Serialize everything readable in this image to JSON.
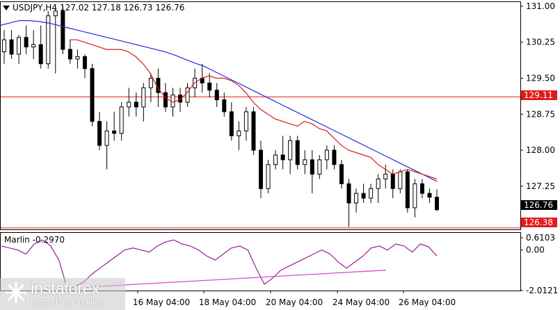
{
  "header": {
    "symbol": "USDJPY,H4",
    "ohlc": "127.02 127.18 126.73 126.76"
  },
  "indicator": {
    "label": "Marlin -0.2970"
  },
  "price_axis": [
    "131.00",
    "130.25",
    "129.50",
    "128.75",
    "128.00",
    "127.25",
    "126.50"
  ],
  "indicator_axis": [
    "0.6103",
    "0.00",
    "-2.0121"
  ],
  "time_axis": [
    "16 May 04:00",
    "18 May 04:00",
    "20 May 04:00",
    "24 May 04:00",
    "26 May 04:00"
  ],
  "price_tags": {
    "current": "126.76",
    "level_upper": "129.11",
    "level_lower": "126.38"
  },
  "colors": {
    "resistance": "#e31b1b",
    "ma_fast": "#d81b1b",
    "ma_slow": "#1f2fd6",
    "oscillator": "#9b1b9b",
    "trendline": "#d24bd6"
  },
  "logo": {
    "name": "instaforex",
    "tagline": "Instant Forex Trading"
  },
  "chart_data": {
    "type": "candlestick",
    "symbol": "USDJPY",
    "timeframe": "H4",
    "ylim": [
      126.35,
      131.1
    ],
    "horizontal_levels": [
      129.11,
      126.38
    ],
    "candles": [
      [
        130.05,
        130.5,
        129.8,
        130.3
      ],
      [
        130.3,
        130.5,
        129.9,
        130.0
      ],
      [
        130.0,
        130.4,
        129.8,
        130.35
      ],
      [
        130.35,
        130.6,
        130.0,
        130.15
      ],
      [
        130.15,
        130.5,
        129.9,
        130.2
      ],
      [
        130.2,
        130.6,
        129.7,
        129.8
      ],
      [
        129.8,
        130.9,
        129.7,
        130.8
      ],
      [
        130.8,
        131.0,
        129.6,
        130.9
      ],
      [
        130.9,
        131.0,
        130.0,
        130.1
      ],
      [
        130.1,
        130.3,
        129.8,
        129.9
      ],
      [
        129.9,
        130.1,
        129.7,
        129.95
      ],
      [
        129.95,
        130.0,
        129.5,
        129.7
      ],
      [
        129.7,
        129.8,
        128.5,
        128.6
      ],
      [
        128.6,
        128.8,
        128.0,
        128.1
      ],
      [
        128.1,
        128.6,
        127.6,
        128.4
      ],
      [
        128.4,
        128.8,
        128.2,
        128.35
      ],
      [
        128.35,
        129.0,
        128.2,
        128.9
      ],
      [
        128.9,
        129.3,
        128.7,
        129.0
      ],
      [
        129.0,
        129.2,
        128.7,
        128.9
      ],
      [
        128.9,
        129.4,
        128.6,
        129.3
      ],
      [
        129.3,
        129.6,
        129.0,
        129.5
      ],
      [
        129.5,
        129.7,
        128.9,
        129.2
      ],
      [
        129.2,
        129.4,
        128.8,
        128.9
      ],
      [
        128.9,
        129.3,
        128.7,
        129.15
      ],
      [
        129.15,
        129.3,
        128.8,
        129.0
      ],
      [
        129.0,
        129.4,
        128.9,
        129.3
      ],
      [
        129.3,
        129.7,
        129.1,
        129.5
      ],
      [
        129.5,
        129.8,
        129.2,
        129.4
      ],
      [
        129.4,
        129.6,
        129.1,
        129.25
      ],
      [
        129.25,
        129.4,
        128.9,
        129.05
      ],
      [
        129.05,
        129.2,
        128.7,
        128.8
      ],
      [
        128.8,
        129.0,
        128.2,
        128.3
      ],
      [
        128.3,
        128.6,
        128.0,
        128.4
      ],
      [
        128.4,
        128.9,
        128.2,
        128.8
      ],
      [
        128.8,
        128.9,
        127.9,
        128.0
      ],
      [
        128.0,
        128.2,
        127.0,
        127.2
      ],
      [
        127.2,
        127.8,
        127.1,
        127.7
      ],
      [
        127.7,
        128.0,
        127.6,
        127.9
      ],
      [
        127.9,
        128.3,
        127.6,
        127.8
      ],
      [
        127.8,
        128.3,
        127.5,
        128.2
      ],
      [
        128.2,
        128.3,
        127.6,
        127.7
      ],
      [
        127.7,
        128.0,
        127.5,
        127.8
      ],
      [
        127.8,
        128.0,
        127.1,
        127.5
      ],
      [
        127.5,
        127.9,
        127.4,
        127.8
      ],
      [
        127.8,
        128.1,
        127.6,
        128.0
      ],
      [
        128.0,
        128.1,
        127.6,
        127.7
      ],
      [
        127.7,
        127.8,
        127.2,
        127.3
      ],
      [
        127.3,
        127.4,
        126.4,
        126.9
      ],
      [
        126.9,
        127.2,
        126.7,
        127.1
      ],
      [
        127.1,
        127.3,
        126.9,
        127.0
      ],
      [
        127.0,
        127.3,
        126.9,
        127.2
      ],
      [
        127.2,
        127.5,
        126.9,
        127.4
      ],
      [
        127.4,
        127.7,
        127.2,
        127.5
      ],
      [
        127.5,
        127.6,
        127.0,
        127.2
      ],
      [
        127.2,
        127.6,
        127.1,
        127.55
      ],
      [
        127.55,
        127.6,
        126.7,
        126.8
      ],
      [
        126.8,
        127.4,
        126.6,
        127.3
      ],
      [
        127.3,
        127.4,
        127.0,
        127.1
      ],
      [
        127.1,
        127.2,
        126.9,
        127.02
      ],
      [
        127.02,
        127.18,
        126.73,
        126.76
      ]
    ],
    "ma_fast": [
      130.3,
      130.3,
      130.25,
      130.2,
      130.15,
      130.1,
      130.1,
      130.1,
      130.05,
      129.95,
      129.8,
      129.6,
      129.3,
      129.1,
      129.0,
      129.05,
      129.2,
      129.4,
      129.5,
      129.55,
      129.5,
      129.5,
      129.45,
      129.35,
      129.2,
      129.0,
      128.85,
      128.75,
      128.65,
      128.6,
      128.55,
      128.5,
      128.6,
      128.55,
      128.45,
      128.4,
      128.25,
      128.1,
      128.0,
      127.95,
      127.9,
      127.85,
      127.7,
      127.6,
      127.5,
      127.55,
      127.6,
      127.55,
      127.5,
      127.45,
      127.4
    ],
    "ma_slow": [
      130.6,
      130.65,
      130.7,
      130.7,
      130.68,
      130.65,
      130.6,
      130.55,
      130.5,
      130.45,
      130.4,
      130.35,
      130.3,
      130.25,
      130.2,
      130.15,
      130.1,
      130.05,
      129.98,
      129.9,
      129.82,
      129.75,
      129.65,
      129.55,
      129.45,
      129.35,
      129.25,
      129.15,
      129.05,
      128.95,
      128.85,
      128.75,
      128.65,
      128.55,
      128.45,
      128.35,
      128.25,
      128.15,
      128.05,
      127.95,
      127.85,
      127.75,
      127.65,
      127.55,
      127.45,
      127.35
    ],
    "oscillator_ylim": [
      -2.0121,
      0.6103
    ],
    "oscillator": [
      0.2,
      0.1,
      0.0,
      -0.2,
      0.3,
      0.5,
      0.2,
      -0.5,
      -1.9,
      -1.8,
      -1.6,
      -1.2,
      -0.9,
      -0.6,
      -0.3,
      0.0,
      0.1,
      0.0,
      -0.1,
      0.2,
      0.4,
      0.5,
      0.3,
      0.2,
      0.0,
      -0.3,
      -0.5,
      -0.2,
      0.1,
      0.2,
      0.0,
      -0.9,
      -1.7,
      -1.4,
      -1.0,
      -0.8,
      -0.6,
      -0.4,
      -0.2,
      0.0,
      -0.2,
      -0.6,
      -0.9,
      -0.6,
      -0.3,
      0.1,
      0.2,
      0.0,
      0.3,
      0.2,
      -0.1,
      0.3,
      0.15,
      -0.3
    ]
  }
}
